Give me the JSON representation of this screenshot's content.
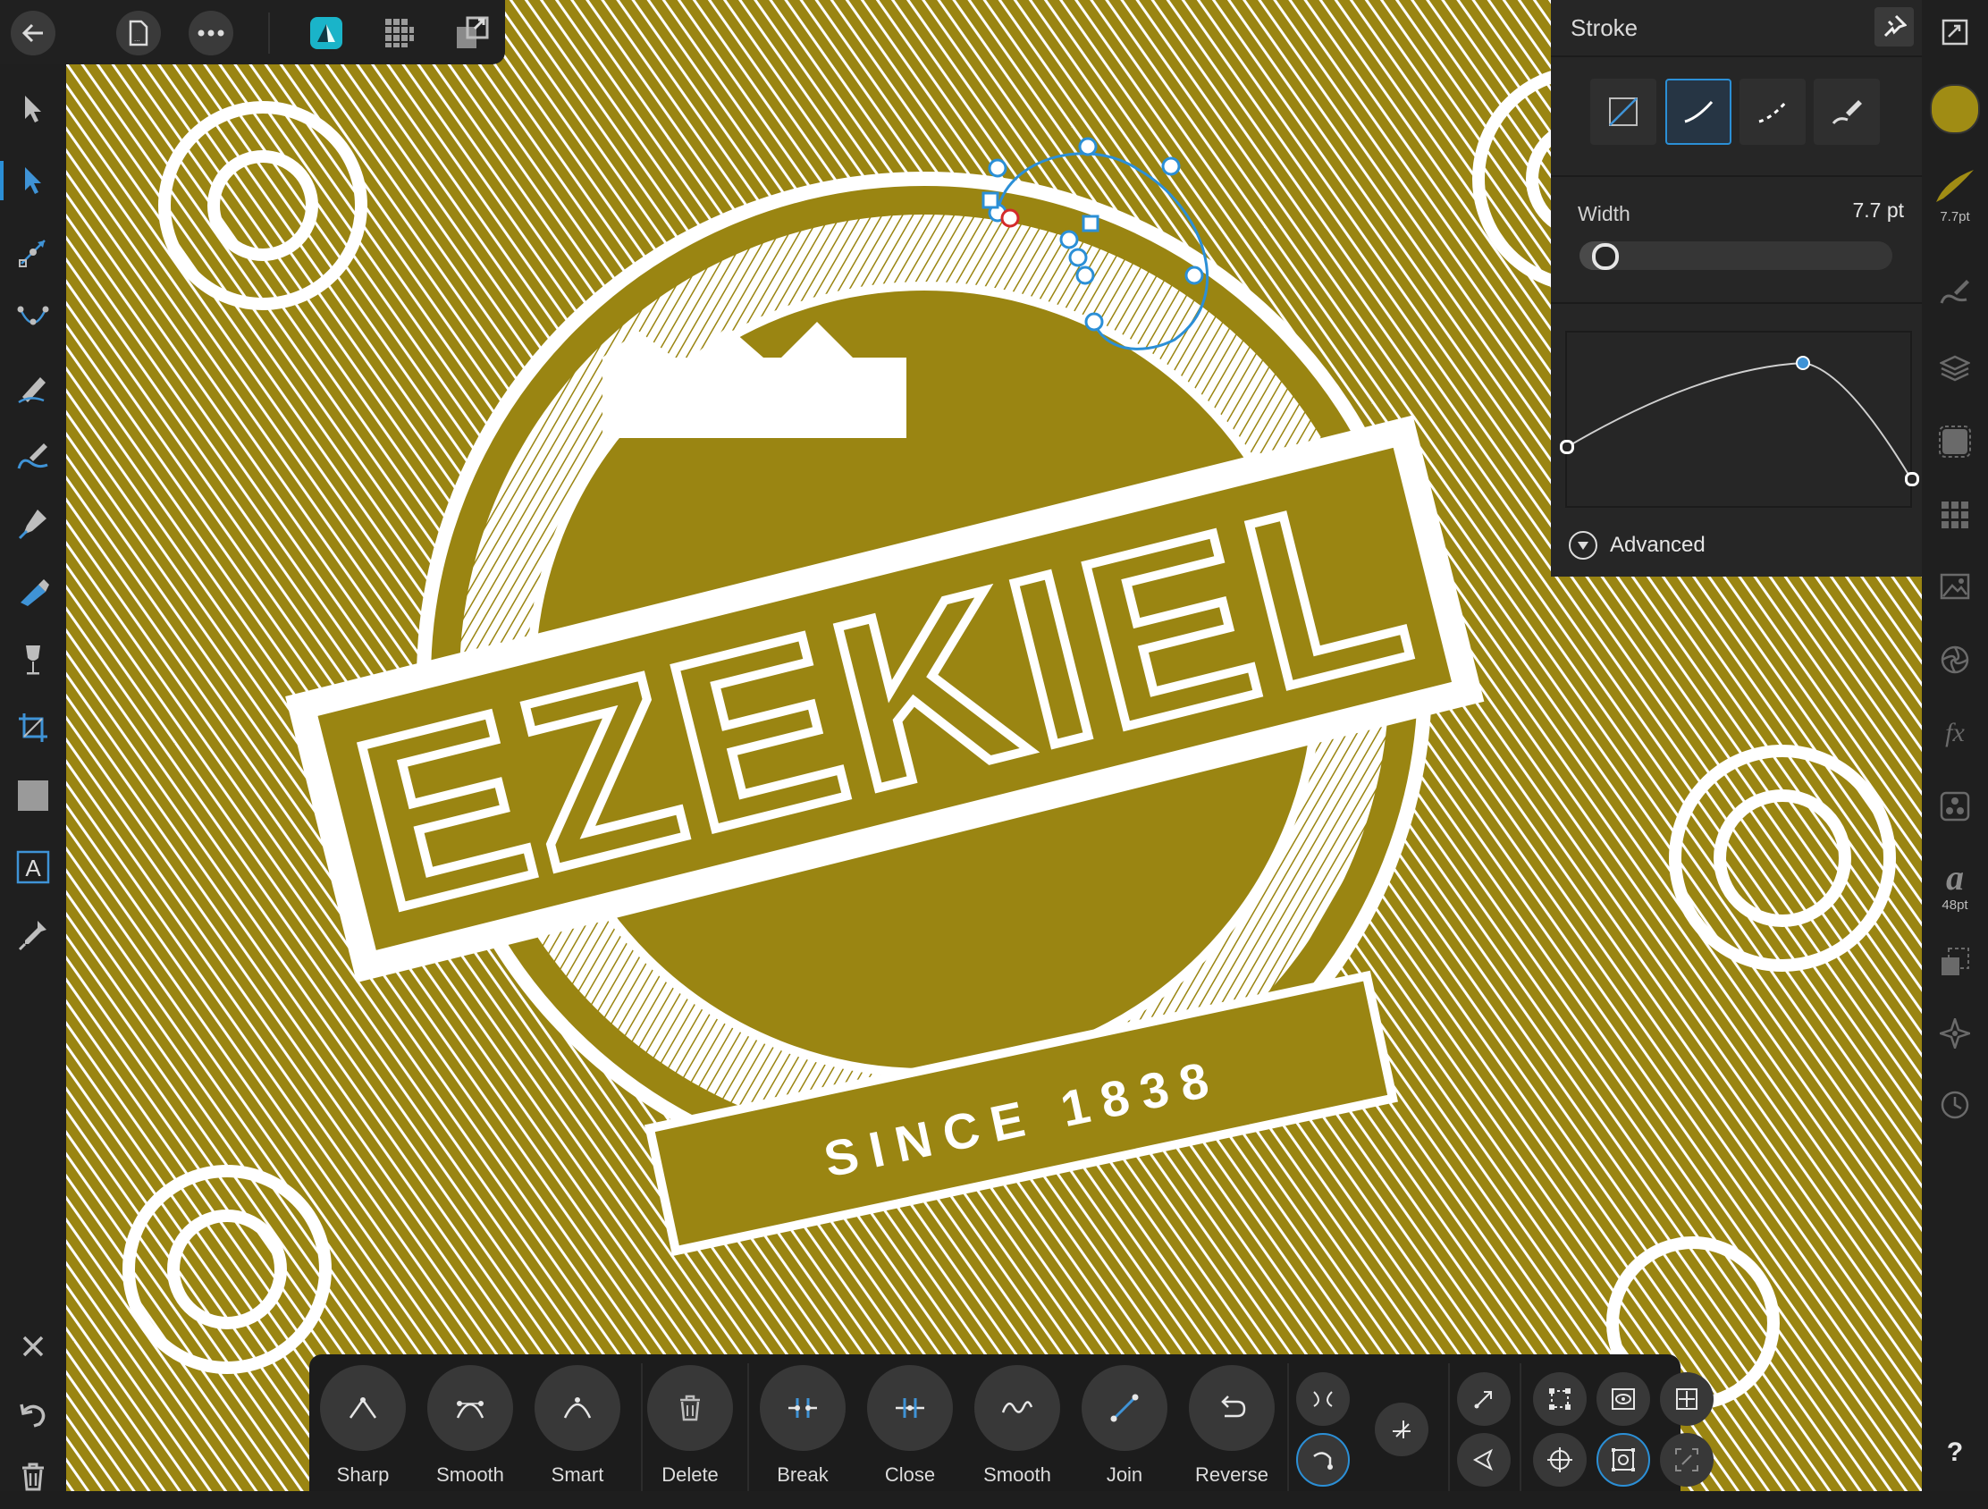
{
  "colors": {
    "accent": "#2b8fd6",
    "artwork": "#9a8512",
    "swatch": "#a08c14",
    "panel": "#262626"
  },
  "topbar": {
    "back_icon": "back-arrow-icon",
    "document_icon": "document-icon",
    "more_icon": "more-icon",
    "persona_designer_icon": "designer-persona-icon",
    "persona_pixel_icon": "pixel-persona-icon",
    "persona_export_icon": "export-persona-icon"
  },
  "left_tools": [
    "move-tool",
    "node-tool",
    "point-transform-tool",
    "corner-tool",
    "pencil-tool",
    "vector-brush-tool",
    "pen-tool",
    "fill-tool",
    "transparency-tool",
    "crop-tool",
    "rectangle-tool",
    "artistic-text-tool",
    "color-picker-tool"
  ],
  "left_bottom": [
    "close-icon",
    "undo-icon",
    "trash-icon"
  ],
  "artwork": {
    "headline": "EZEKIEL",
    "ribbon": "SINCE 1838"
  },
  "stroke_panel": {
    "title": "Stroke",
    "width_label": "Width",
    "width_value": "7.7 pt",
    "width_fraction": 0.04,
    "advanced_label": "Advanced",
    "styles": [
      "none-stroke",
      "solid-stroke",
      "dashed-stroke",
      "texture-stroke"
    ],
    "active_style": "solid-stroke"
  },
  "right_bar": {
    "brush_size_label": "7.7pt",
    "text_size_label": "48pt",
    "text_glyph": "a",
    "fx_label": "fx",
    "help_label": "?"
  },
  "bottom_toolbar": {
    "items": [
      {
        "label": "Sharp"
      },
      {
        "label": "Smooth"
      },
      {
        "label": "Smart"
      },
      {
        "label": "Delete"
      },
      {
        "label": "Break"
      },
      {
        "label": "Close"
      },
      {
        "label": "Smooth"
      },
      {
        "label": "Join"
      },
      {
        "label": "Reverse"
      }
    ]
  }
}
